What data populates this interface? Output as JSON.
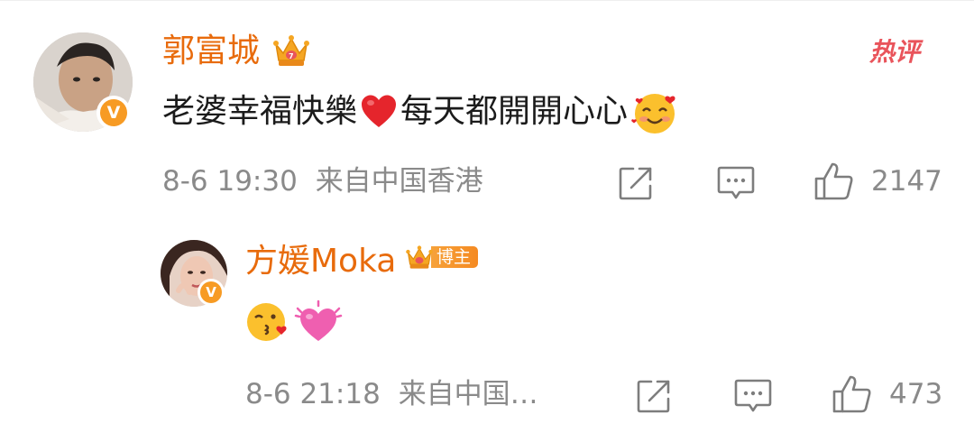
{
  "comment": {
    "username": "郭富城",
    "text": "老婆幸福快樂",
    "text_after_heart": "每天都開開心心",
    "hot_tag": "热评",
    "time": "8-6 19:30",
    "location": "来自中国香港",
    "like_count": "2147",
    "icons": {
      "crown": "crown-icon",
      "heart": "red-heart-emoji",
      "smile": "smiling-face-with-hearts-emoji",
      "share": "share-icon",
      "reply": "comment-icon",
      "like": "thumbs-up-icon"
    }
  },
  "reply": {
    "username": "方媛Moka",
    "badge_label": "博主",
    "time": "8-6 21:18",
    "location": "来自中国…",
    "like_count": "473",
    "icons": {
      "kiss": "face-blowing-kiss-emoji",
      "heart": "beating-heart-emoji",
      "share": "share-icon",
      "reply": "comment-icon",
      "like": "thumbs-up-icon"
    }
  },
  "colors": {
    "username": "#e86b0c",
    "hot_tag": "#e9545b",
    "meta": "#8a8a8a",
    "text": "#1b1b1b",
    "verified": "#f79b24",
    "crown": "#f5a623"
  }
}
